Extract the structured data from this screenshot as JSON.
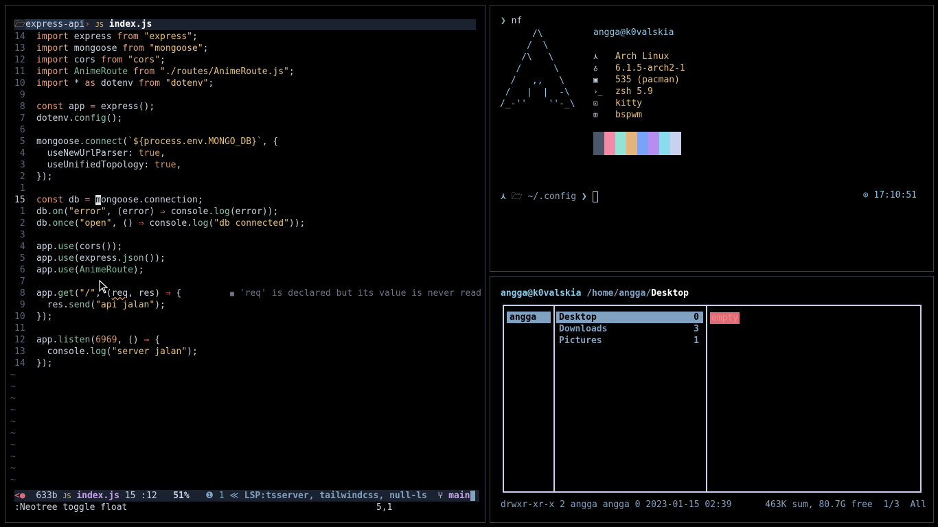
{
  "editor": {
    "tabline": {
      "project": "express-api",
      "filename": "index.js"
    },
    "lines": [
      {
        "n": "14",
        "t": "import express from \"express\";"
      },
      {
        "n": "13",
        "t": "import mongoose from \"mongoose\";"
      },
      {
        "n": "12",
        "t": "import cors from \"cors\";"
      },
      {
        "n": "11",
        "t": "import AnimeRoute from \"./routes/AnimeRoute.js\";"
      },
      {
        "n": "10",
        "t": "import * as dotenv from \"dotenv\";"
      },
      {
        "n": "9",
        "t": ""
      },
      {
        "n": "8",
        "t": "const app = express();"
      },
      {
        "n": "7",
        "t": "dotenv.config();"
      },
      {
        "n": "6",
        "t": ""
      },
      {
        "n": "5",
        "t": "mongoose.connect(`${process.env.MONGO_DB}`, {"
      },
      {
        "n": "4",
        "t": "  useNewUrlParser: true,"
      },
      {
        "n": "3",
        "t": "  useUnifiedTopology: true,"
      },
      {
        "n": "2",
        "t": "});"
      },
      {
        "n": "1",
        "t": ""
      },
      {
        "n": "15",
        "t": "const db = mongoose.connection;"
      },
      {
        "n": "1",
        "t": "db.on(\"error\", (error) ⇒ console.log(error));"
      },
      {
        "n": "2",
        "t": "db.once(\"open\", () ⇒ console.log(\"db connected\"));"
      },
      {
        "n": "3",
        "t": ""
      },
      {
        "n": "4",
        "t": "app.use(cors());"
      },
      {
        "n": "5",
        "t": "app.use(express.json());"
      },
      {
        "n": "6",
        "t": "app.use(AnimeRoute);"
      },
      {
        "n": "7",
        "t": ""
      },
      {
        "n": "8",
        "t": "app.get(\"/\", (req, res) ⇒ {"
      },
      {
        "n": "9",
        "t": "  res.send(\"api jalan\");"
      },
      {
        "n": "10",
        "t": "});"
      },
      {
        "n": "11",
        "t": ""
      },
      {
        "n": "12",
        "t": "app.listen(6969, () ⇒ {"
      },
      {
        "n": "13",
        "t": "  console.log(\"server jalan\");"
      },
      {
        "n": "14",
        "t": "});"
      }
    ],
    "diagnostic": "'req' is declared but its value is never read",
    "tilde": "~",
    "tilde_count": 10,
    "status": {
      "size": "633b",
      "filename": "index.js",
      "position": "15 :12",
      "percent": "51%",
      "info_count": "1",
      "lsp": "LSP:tsserver, tailwindcss, null-ls",
      "branch": "main"
    },
    "cmdline": ":Neotree toggle float",
    "cursor_pos": "5,1"
  },
  "neofetch": {
    "command": "nf",
    "logo": [
      "      /\\",
      "     /  \\",
      "    /\\   \\",
      "   /      \\",
      "  /   ,,   \\",
      " /   |  |  -\\",
      "/_-''    ''-_\\"
    ],
    "user": "angga@k0valskia",
    "info": [
      {
        "icon": "arch-icon",
        "glyph": "⋏",
        "value": "Arch Linux"
      },
      {
        "icon": "kernel-icon",
        "glyph": "♁",
        "value": "6.1.5-arch2-1"
      },
      {
        "icon": "package-icon",
        "glyph": "▣",
        "value": "535 (pacman)"
      },
      {
        "icon": "shell-icon",
        "glyph": "›_",
        "value": "zsh 5.9"
      },
      {
        "icon": "terminal-icon",
        "glyph": "⊡",
        "value": "kitty"
      },
      {
        "icon": "wm-icon",
        "glyph": "⊞",
        "value": "bspwm"
      }
    ],
    "palette": [
      "#4c566a",
      "#f38ba8",
      "#94e2d5",
      "#e5b47a",
      "#7aa2f7",
      "#b48ef0",
      "#89dceb",
      "#c9d1f0"
    ],
    "prompt_path": "~/.config",
    "clock": "17:10:51"
  },
  "filemanager": {
    "user": "angga@k0valskia",
    "path_prefix": "/home/angga/",
    "path_current": "Desktop",
    "parent": "angga",
    "entries": [
      {
        "name": "Desktop",
        "count": "0",
        "selected": true
      },
      {
        "name": "Downloads",
        "count": "3",
        "selected": false
      },
      {
        "name": "Pictures",
        "count": "1",
        "selected": false
      }
    ],
    "preview": "empty",
    "status_left": "drwxr-xr-x 2 angga angga 0 2023-01-15 02:39",
    "status_right": "463K sum, 80.7G free  1/3  All"
  }
}
